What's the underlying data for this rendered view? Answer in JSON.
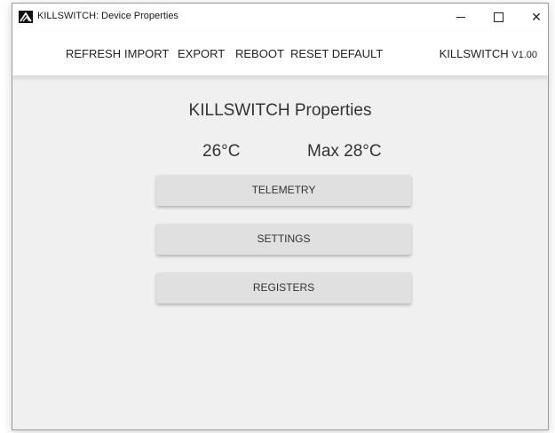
{
  "window": {
    "title": "KILLSWITCH: Device Properties",
    "controls": {
      "minimize": "–",
      "close": "✕"
    }
  },
  "menu": {
    "items": [
      "REFRESH",
      "IMPORT",
      "EXPORT",
      "REBOOT",
      "RESET DEFAULT"
    ],
    "brand_name": "KILLSWITCH",
    "brand_version": "V1.00"
  },
  "main": {
    "title": "KILLSWITCH Properties",
    "current_temp": "26°C",
    "max_temp": "Max 28°C",
    "buttons": [
      "TELEMETRY",
      "SETTINGS",
      "REGISTERS"
    ]
  },
  "colors": {
    "background": "#f0f0f0",
    "menubar": "#ffffff",
    "button": "#e0e0e0",
    "text": "#333333"
  },
  "icons": {
    "app": "mountain-logo-icon",
    "minimize": "minimize-icon",
    "maximize": "maximize-icon",
    "close": "close-icon"
  }
}
